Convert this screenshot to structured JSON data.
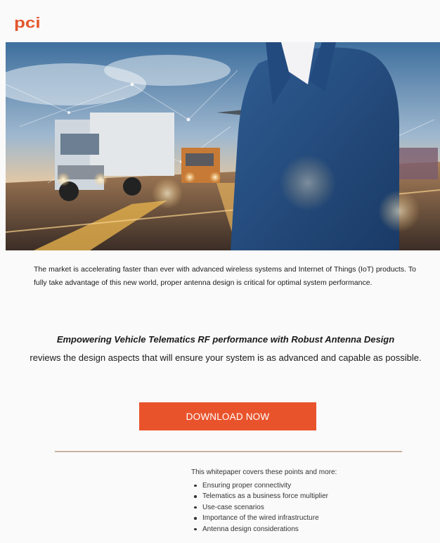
{
  "brand": {
    "logo_text": "pci",
    "accent": "#e9532c"
  },
  "hero": {
    "image_name": "hero-trucks-businessman-image"
  },
  "intro": {
    "text": "The market is accelerating faster than ever with advanced wireless systems and Internet of Things (IoT) products. To fully take advantage of this new world, proper antenna design is critical for optimal system performance."
  },
  "feature": {
    "title": "Empowering Vehicle Telematics RF performance with Robust Antenna Design",
    "text": "reviews the design aspects that will ensure your system is as advanced and capable as possible."
  },
  "cta": {
    "label": "DOWNLOAD NOW"
  },
  "points": {
    "heading": "This whitepaper covers these points and more:",
    "items": [
      "Ensuring proper connectivity",
      "Telematics as a business force multiplier",
      "Use-case scenarios",
      "Importance of the wired infrastructure",
      "Antenna design considerations"
    ]
  }
}
